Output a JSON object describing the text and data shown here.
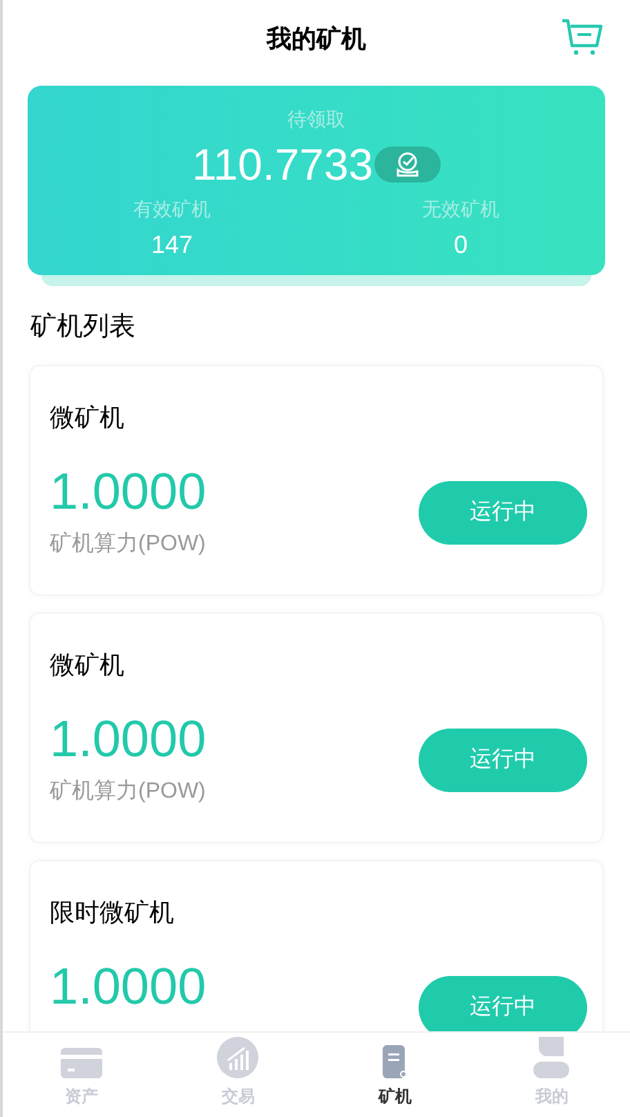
{
  "header": {
    "title": "我的矿机"
  },
  "summary": {
    "pending_label": "待领取",
    "pending_value": "110.7733",
    "stats": [
      {
        "label": "有效矿机",
        "value": "147"
      },
      {
        "label": "无效矿机",
        "value": "0"
      }
    ]
  },
  "section_title": "矿机列表",
  "miners": [
    {
      "name": "微矿机",
      "power": "1.0000",
      "power_label": "矿机算力(POW)",
      "status": "运行中"
    },
    {
      "name": "微矿机",
      "power": "1.0000",
      "power_label": "矿机算力(POW)",
      "status": "运行中"
    },
    {
      "name": "限时微矿机",
      "power": "1.0000",
      "status": "运行中"
    }
  ],
  "nav": [
    {
      "kind": "assets",
      "label": "资产",
      "selected": false
    },
    {
      "kind": "trade",
      "label": "交易",
      "selected": false
    },
    {
      "kind": "miner",
      "label": "矿机",
      "selected": true
    },
    {
      "kind": "profile",
      "label": "我的",
      "selected": false
    }
  ]
}
